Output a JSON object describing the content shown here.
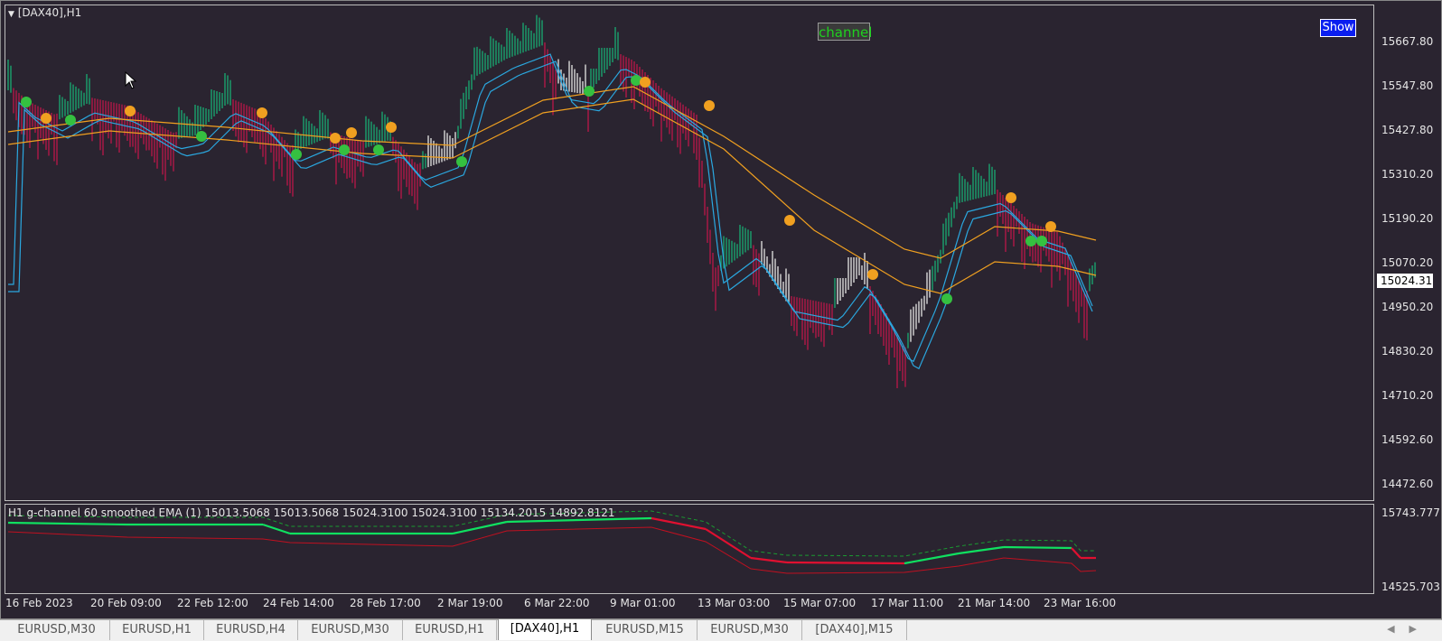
{
  "window": {
    "symbol_label": "[DAX40],H1"
  },
  "buttons": {
    "channel": "channel",
    "show": "Show"
  },
  "indicator": {
    "label": "H1 g-channel  60 smoothed EMA (1) 15013.5068 15013.5068 15024.3100 15024.3100 15134.2015 14892.8121",
    "axis_top": "15743.777",
    "axis_bottom": "14525.703"
  },
  "price_axis": {
    "labels": [
      "15667.80",
      "15547.80",
      "15427.80",
      "15310.20",
      "15190.20",
      "15070.20",
      "14950.20",
      "14830.20",
      "14710.20",
      "14592.60",
      "14472.60"
    ],
    "current_price": "15024.31"
  },
  "time_axis": {
    "labels": [
      "16 Feb 2023",
      "20 Feb 09:00",
      "22 Feb 12:00",
      "24 Feb 14:00",
      "28 Feb 17:00",
      "2 Mar 19:00",
      "6 Mar 22:00",
      "9 Mar 01:00",
      "13 Mar 03:00",
      "15 Mar 07:00",
      "17 Mar 11:00",
      "21 Mar 14:00",
      "23 Mar 16:00"
    ]
  },
  "tabs": [
    {
      "label": "EURUSD,M30",
      "active": false
    },
    {
      "label": "EURUSD,H1",
      "active": false
    },
    {
      "label": "EURUSD,H4",
      "active": false
    },
    {
      "label": "EURUSD,M30",
      "active": false
    },
    {
      "label": "EURUSD,H1",
      "active": false
    },
    {
      "label": "[DAX40],H1",
      "active": true
    },
    {
      "label": "EURUSD,M15",
      "active": false
    },
    {
      "label": "EURUSD,M30",
      "active": false
    },
    {
      "label": "[DAX40],M15",
      "active": false
    }
  ],
  "colors": {
    "background": "#2a2430",
    "bull_bar": "#1aa36e",
    "bear_bar": "#b01848",
    "neutral_bar": "#d8d8d8",
    "ema_fast": "#2aa8e0",
    "ema_slow": "#f0a020",
    "signal_up": "#35c040",
    "signal_down": "#f0a020",
    "channel_line_up": "#10e060",
    "channel_line_down": "#e01030"
  },
  "icons": {
    "cursor": "mouse-pointer-icon",
    "menu": "triangle-down-icon",
    "scroll": "scroll-arrows-icon"
  }
}
